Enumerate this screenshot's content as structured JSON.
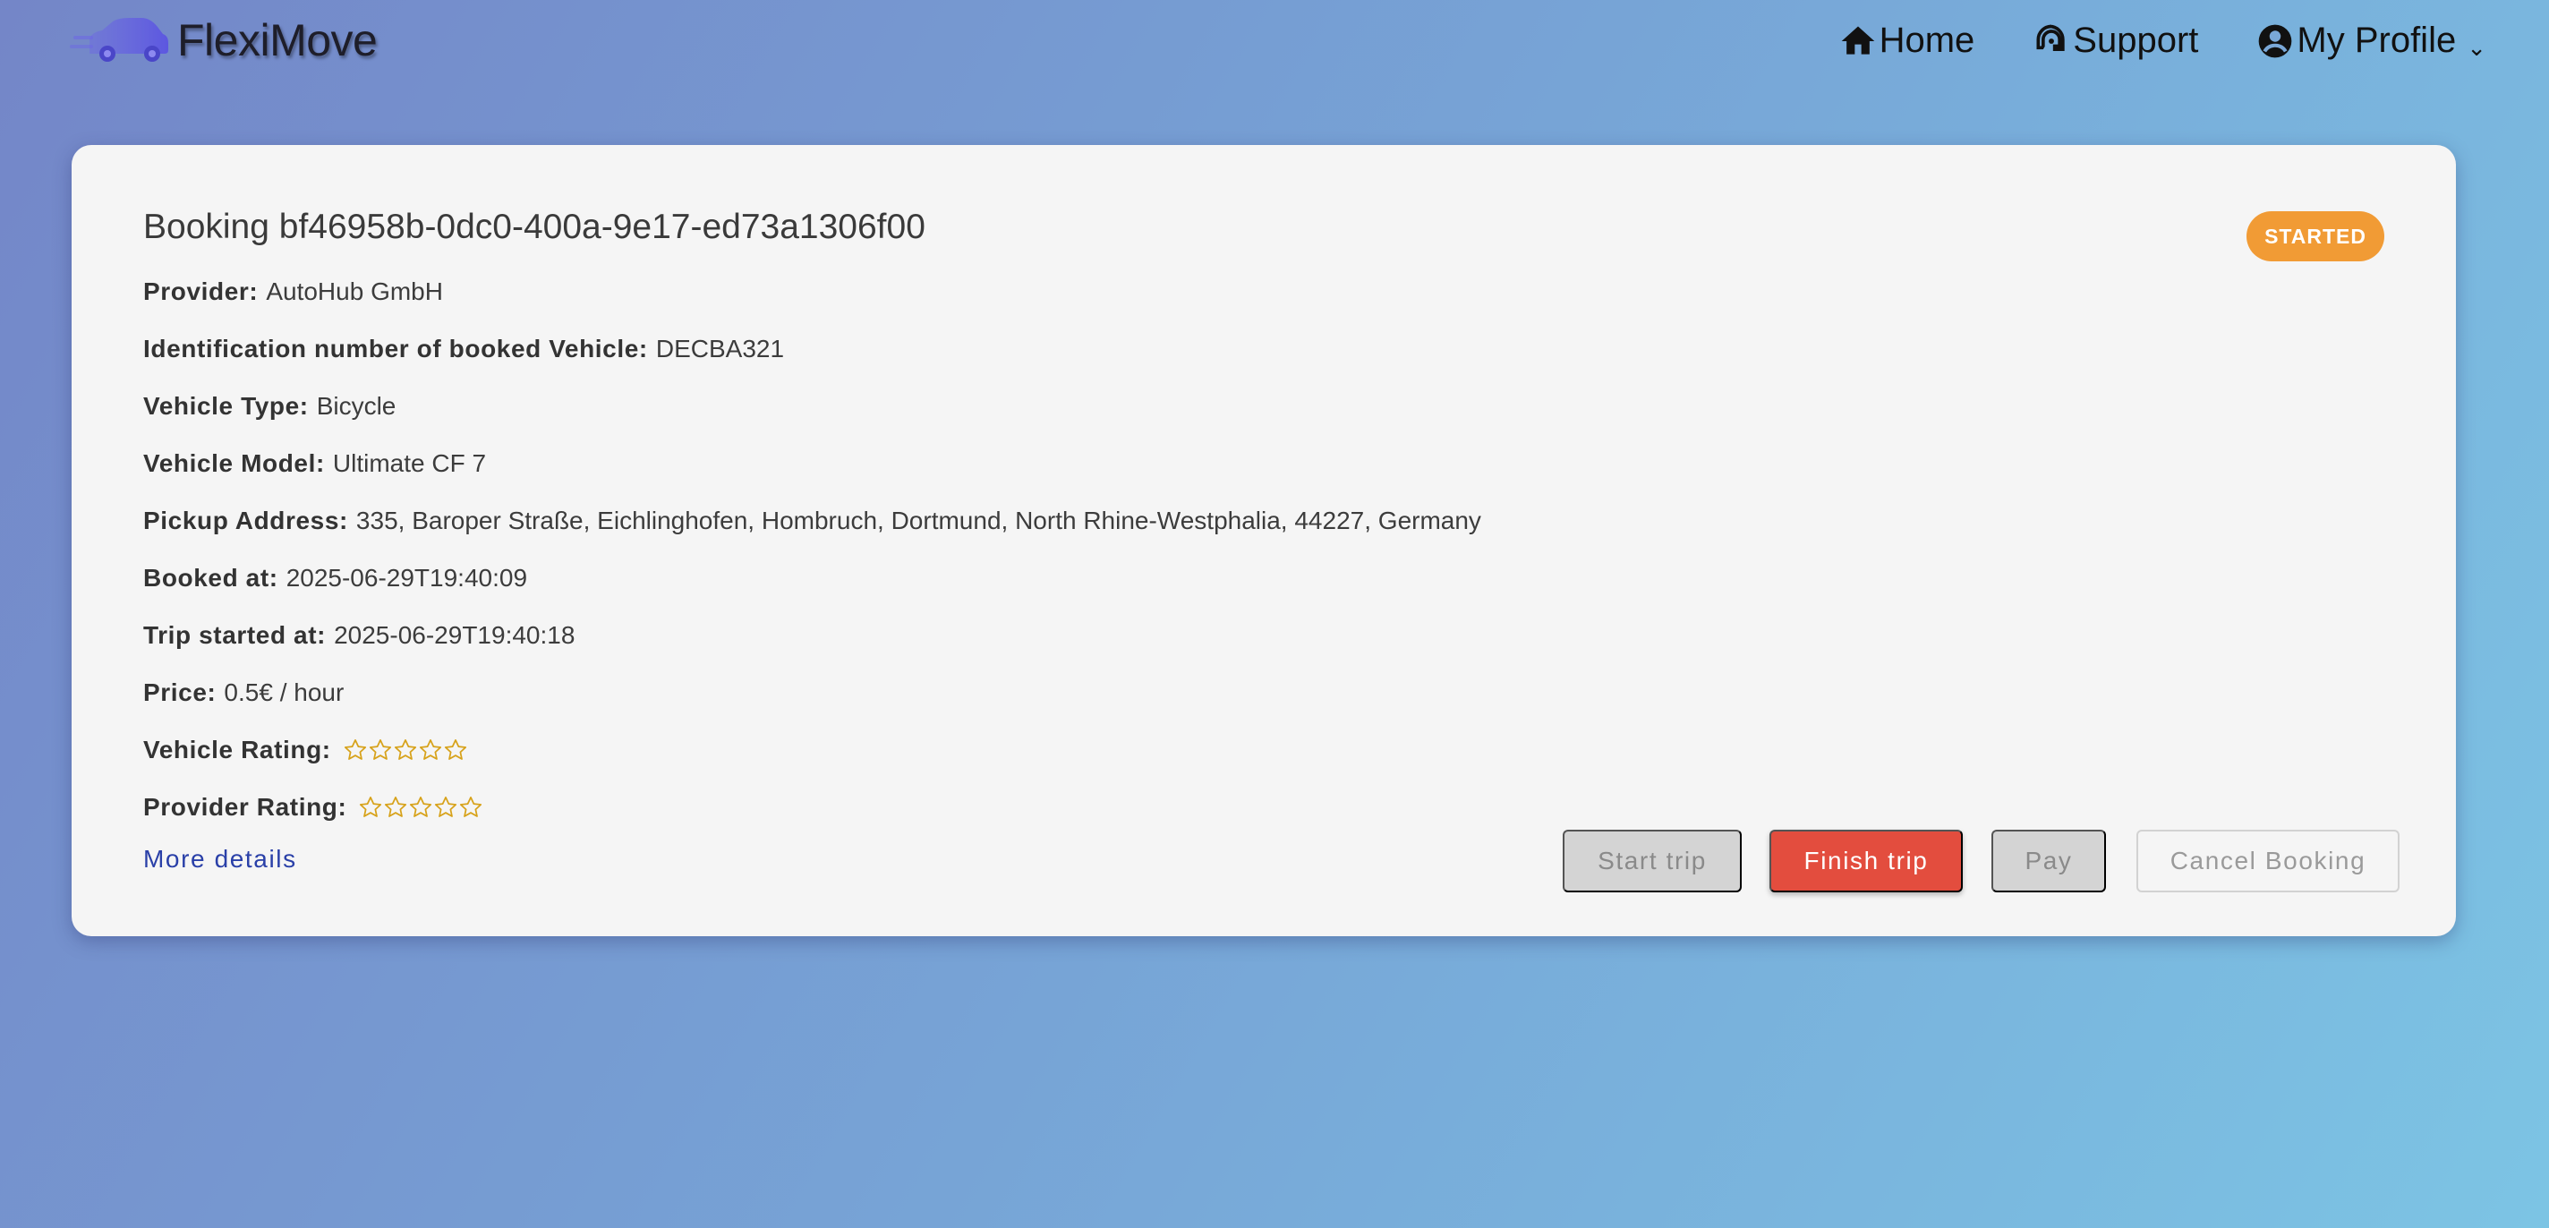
{
  "app": {
    "name": "FlexiMove"
  },
  "nav": {
    "home": "Home",
    "support": "Support",
    "profile": "My Profile",
    "profile_chevron": "⌄"
  },
  "booking": {
    "title": "Booking bf46958b-0dc0-400a-9e17-ed73a1306f00",
    "status": "STARTED",
    "status_color": "#f19b35",
    "fields": [
      {
        "label": "Provider:",
        "value": "AutoHub GmbH"
      },
      {
        "label": "Identification number of booked Vehicle:",
        "value": "DECBA321"
      },
      {
        "label": "Vehicle Type:",
        "value": "Bicycle"
      },
      {
        "label": "Vehicle Model:",
        "value": "Ultimate CF 7"
      },
      {
        "label": "Pickup Address:",
        "value": "335, Baroper Straße, Eichlinghofen, Hombruch, Dortmund, North Rhine-Westphalia, 44227, Germany"
      },
      {
        "label": "Booked at:",
        "value": "2025-06-29T19:40:09"
      },
      {
        "label": "Trip started at:",
        "value": "2025-06-29T19:40:18"
      },
      {
        "label": "Price:",
        "value": "0.5€ / hour"
      }
    ],
    "ratings": [
      {
        "label": "Vehicle Rating:",
        "stars": 0,
        "max": 5
      },
      {
        "label": "Provider Rating:",
        "stars": 0,
        "max": 5
      }
    ],
    "more_details": "More details",
    "buttons": {
      "start": "Start trip",
      "finish": "Finish trip",
      "pay": "Pay",
      "cancel": "Cancel Booking"
    }
  }
}
